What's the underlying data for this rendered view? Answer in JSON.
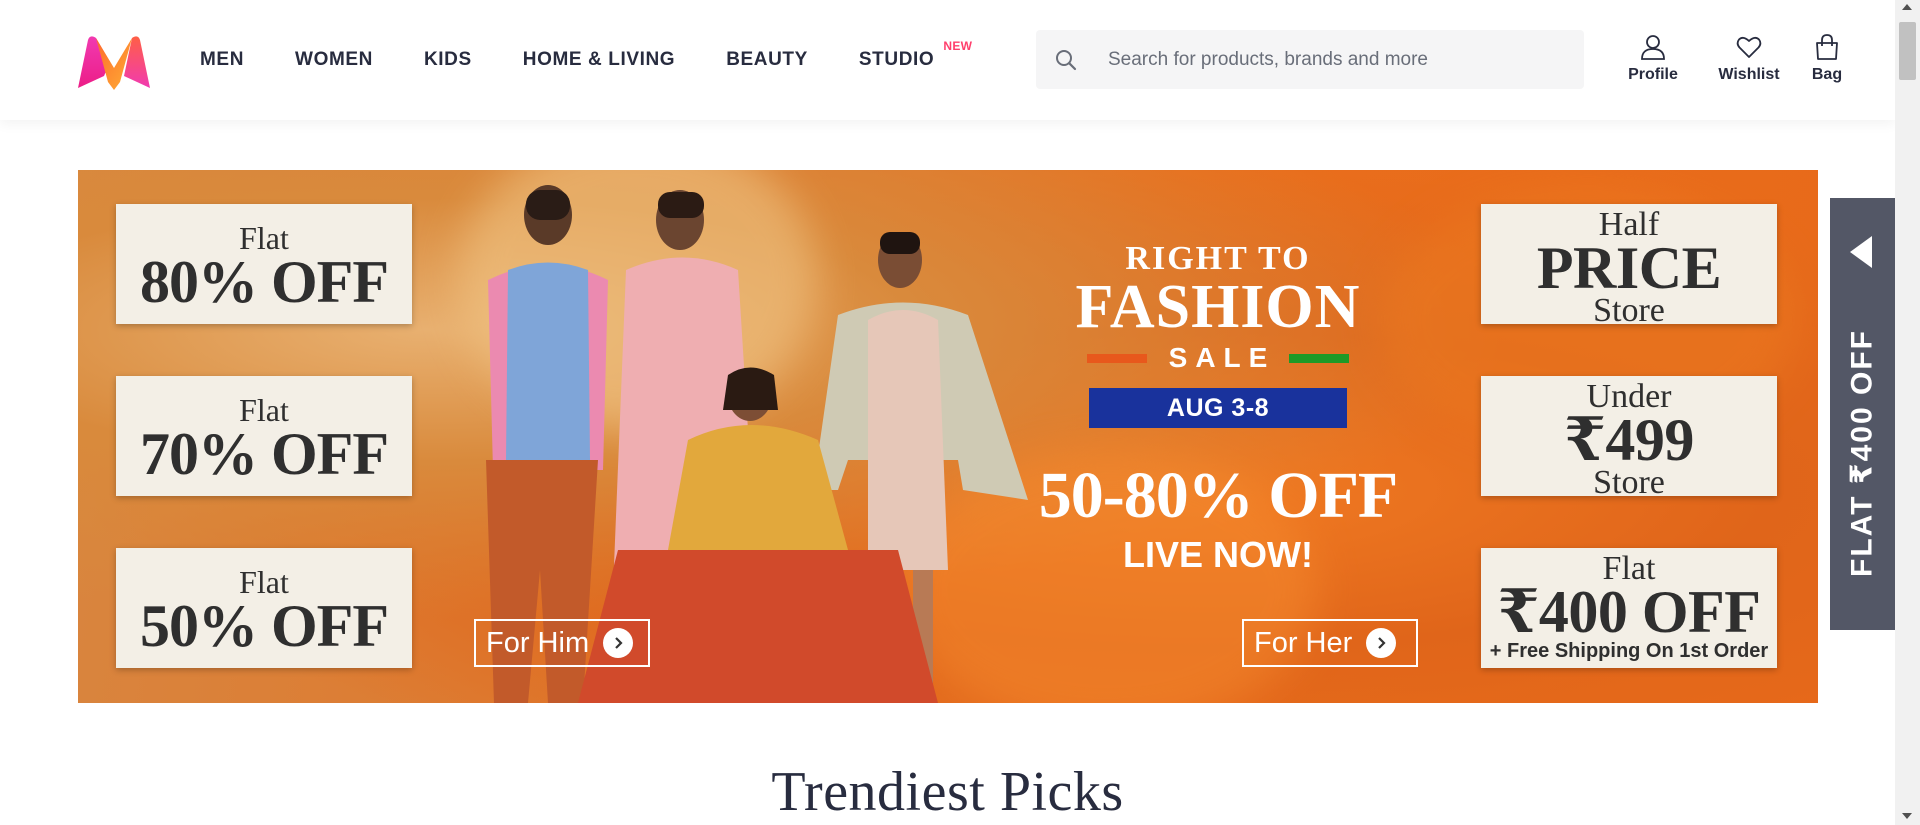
{
  "header": {
    "nav": [
      {
        "label": "MEN"
      },
      {
        "label": "WOMEN"
      },
      {
        "label": "KIDS"
      },
      {
        "label": "HOME & LIVING"
      },
      {
        "label": "BEAUTY"
      },
      {
        "label": "STUDIO",
        "tag": "NEW"
      }
    ],
    "search": {
      "placeholder": "Search for products, brands and more"
    },
    "actions": {
      "profile": "Profile",
      "wishlist": "Wishlist",
      "bag": "Bag"
    }
  },
  "banner": {
    "left_offers": [
      {
        "small": "Flat",
        "big": "80% OFF"
      },
      {
        "small": "Flat",
        "big": "70% OFF"
      },
      {
        "small": "Flat",
        "big": "50% OFF"
      }
    ],
    "right_offers": [
      {
        "top": "Half",
        "big": "PRICE",
        "bottom": "Store"
      },
      {
        "top": "Under",
        "big": "₹499",
        "bottom": "Store"
      },
      {
        "top": "Flat",
        "big": "₹400 OFF",
        "sub": "+ Free Shipping On 1st Order"
      }
    ],
    "sale": {
      "line1": "RIGHT TO",
      "line2": "FASHION",
      "word": "SALE",
      "date": "AUG 3-8",
      "discount": "50-80% OFF",
      "status": "LIVE NOW!"
    },
    "cta_him": "For Him",
    "cta_her": "For Her",
    "colors": {
      "bar_orange": "#e8581c",
      "bar_green": "#1d9a27",
      "date_bg": "#19329c"
    }
  },
  "side_tab": {
    "label": "FLAT ₹400 OFF"
  },
  "section": {
    "title": "Trendiest Picks"
  },
  "brand": {
    "accent": "#ff3f6c"
  }
}
